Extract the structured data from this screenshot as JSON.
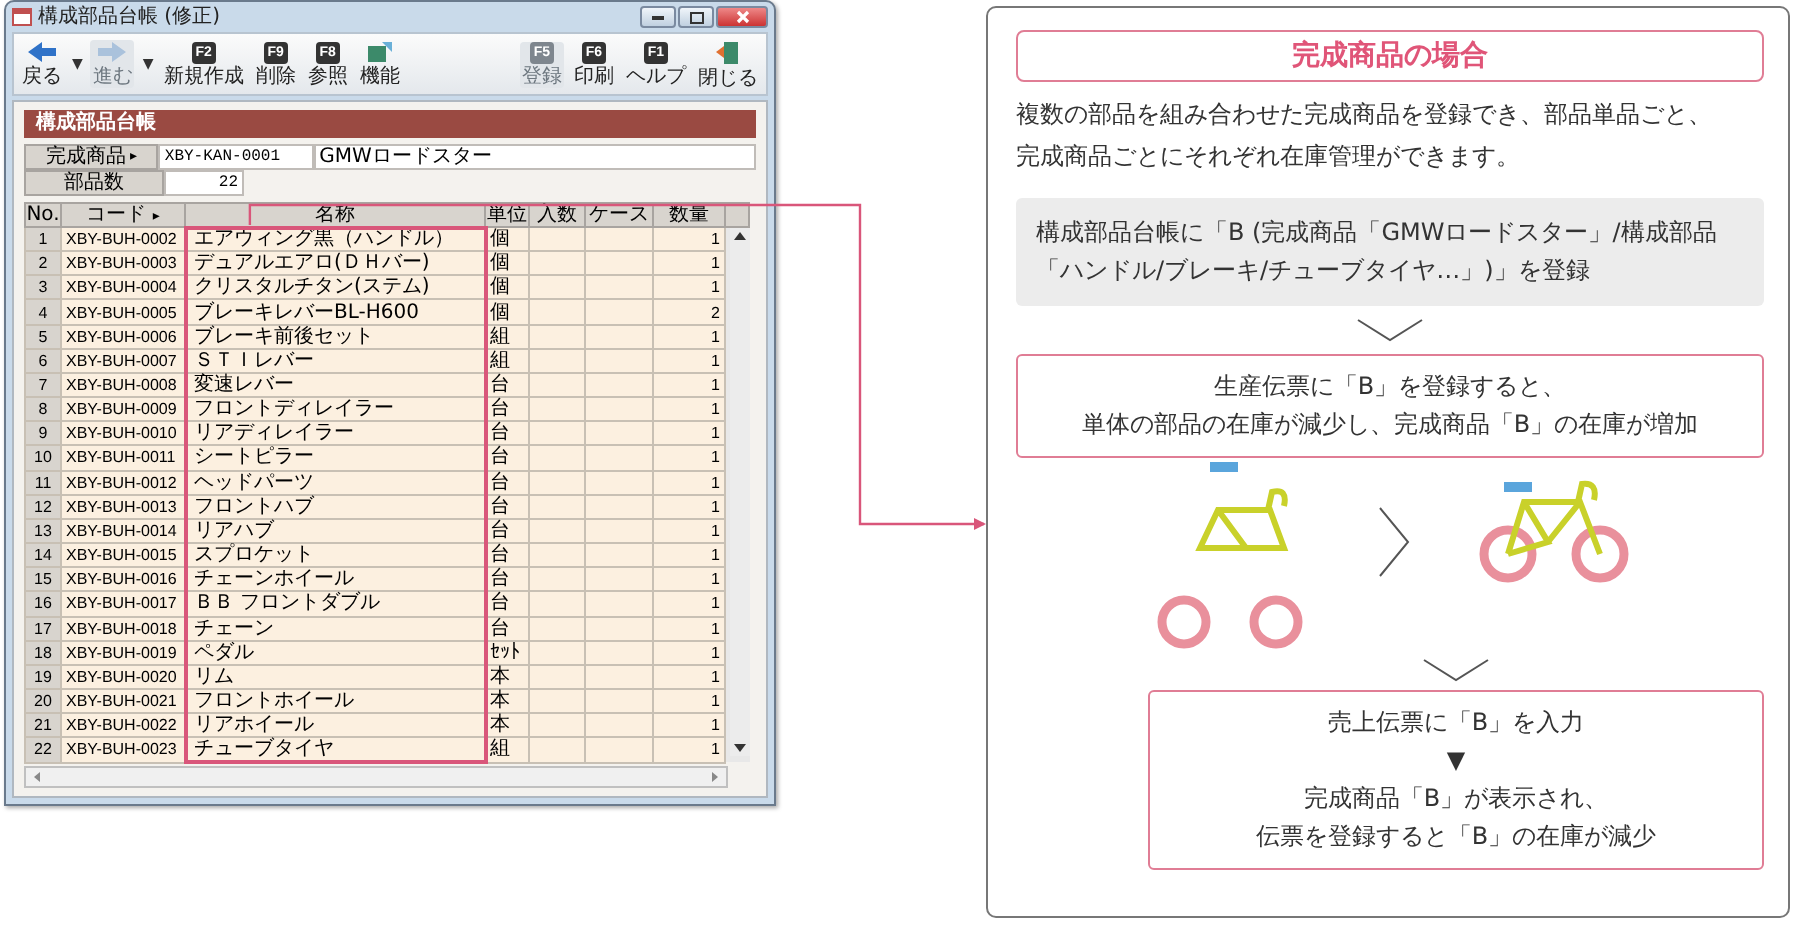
{
  "window": {
    "title": "構成部品台帳 (修正)",
    "toolbar_left": [
      {
        "kind": "back",
        "label": "戻る",
        "caret": "▼",
        "disabled": false
      },
      {
        "kind": "forward",
        "label": "進む",
        "caret": "▼",
        "disabled": true
      },
      {
        "kind": "key",
        "key": "F2",
        "label": "新規作成",
        "disabled": false
      },
      {
        "kind": "key",
        "key": "F9",
        "label": "削除",
        "disabled": false
      },
      {
        "kind": "key",
        "key": "F8",
        "label": "参照",
        "disabled": false
      },
      {
        "kind": "tool",
        "label": "機能",
        "disabled": false
      }
    ],
    "toolbar_right": [
      {
        "kind": "key",
        "key": "F5",
        "label": "登録",
        "disabled": true
      },
      {
        "kind": "key",
        "key": "F6",
        "label": "印刷",
        "disabled": false
      },
      {
        "kind": "key",
        "key": "F1",
        "label": "ヘルプ",
        "disabled": false
      },
      {
        "kind": "exit",
        "label": "閉じる",
        "disabled": false
      }
    ],
    "form_title": "構成部品台帳",
    "fields": [
      {
        "label": "完成商品",
        "lookup_mark": "▸",
        "values": [
          "XBY-KAN-0001",
          "GMWロードスター"
        ]
      },
      {
        "label": "部品数",
        "values": [
          "22"
        ]
      }
    ],
    "table": {
      "columns": [
        {
          "label": "No."
        },
        {
          "label": "コード",
          "lookup_mark": "▸"
        },
        {
          "label": "名称"
        },
        {
          "label": "単位"
        },
        {
          "label": "入数"
        },
        {
          "label": "ケース"
        },
        {
          "label": "数量"
        }
      ],
      "rows": [
        {
          "no": "1",
          "code": "XBY-BUH-0002",
          "name": "エアウィング黒（ハンドル）",
          "unit": "個",
          "qty": "1"
        },
        {
          "no": "2",
          "code": "XBY-BUH-0003",
          "name": "デュアルエアロ(ＤＨバー)",
          "unit": "個",
          "qty": "1"
        },
        {
          "no": "3",
          "code": "XBY-BUH-0004",
          "name": "クリスタルチタン(ステム)",
          "unit": "個",
          "qty": "1"
        },
        {
          "no": "4",
          "code": "XBY-BUH-0005",
          "name": "ブレーキレバーBL-H600",
          "unit": "個",
          "qty": "2"
        },
        {
          "no": "5",
          "code": "XBY-BUH-0006",
          "name": "ブレーキ前後セット",
          "unit": "組",
          "qty": "1"
        },
        {
          "no": "6",
          "code": "XBY-BUH-0007",
          "name": "ＳＴＩレバー",
          "unit": "組",
          "qty": "1"
        },
        {
          "no": "7",
          "code": "XBY-BUH-0008",
          "name": "変速レバー",
          "unit": "台",
          "qty": "1"
        },
        {
          "no": "8",
          "code": "XBY-BUH-0009",
          "name": "フロントディレイラー",
          "unit": "台",
          "qty": "1"
        },
        {
          "no": "9",
          "code": "XBY-BUH-0010",
          "name": "リアディレイラー",
          "unit": "台",
          "qty": "1"
        },
        {
          "no": "10",
          "code": "XBY-BUH-0011",
          "name": "シートピラー",
          "unit": "台",
          "qty": "1"
        },
        {
          "no": "11",
          "code": "XBY-BUH-0012",
          "name": "ヘッドパーツ",
          "unit": "台",
          "qty": "1"
        },
        {
          "no": "12",
          "code": "XBY-BUH-0013",
          "name": "フロントハブ",
          "unit": "台",
          "qty": "1"
        },
        {
          "no": "13",
          "code": "XBY-BUH-0014",
          "name": "リアハブ",
          "unit": "台",
          "qty": "1"
        },
        {
          "no": "14",
          "code": "XBY-BUH-0015",
          "name": "スプロケット",
          "unit": "台",
          "qty": "1"
        },
        {
          "no": "15",
          "code": "XBY-BUH-0016",
          "name": "チェーンホイール",
          "unit": "台",
          "qty": "1"
        },
        {
          "no": "16",
          "code": "XBY-BUH-0017",
          "name": "ＢＢ フロントダブル",
          "unit": "台",
          "qty": "1"
        },
        {
          "no": "17",
          "code": "XBY-BUH-0018",
          "name": "チェーン",
          "unit": "台",
          "qty": "1"
        },
        {
          "no": "18",
          "code": "XBY-BUH-0019",
          "name": "ペダル",
          "unit": "ｾｯﾄ",
          "qty": "1"
        },
        {
          "no": "19",
          "code": "XBY-BUH-0020",
          "name": "リム",
          "unit": "本",
          "qty": "1"
        },
        {
          "no": "20",
          "code": "XBY-BUH-0021",
          "name": "フロントホイール",
          "unit": "本",
          "qty": "1"
        },
        {
          "no": "21",
          "code": "XBY-BUH-0022",
          "name": "リアホイール",
          "unit": "本",
          "qty": "1"
        },
        {
          "no": "22",
          "code": "XBY-BUH-0023",
          "name": "チューブタイヤ",
          "unit": "組",
          "qty": "1"
        }
      ]
    }
  },
  "panel": {
    "title": "完成商品の場合",
    "description": [
      "複数の部品を組み合わせた完成商品を登録でき、部品単品ごと、",
      "完成商品ごとにそれぞれ在庫管理ができます。"
    ],
    "steps": [
      {
        "kind": "grey",
        "lines": [
          "構成部品台帳に「B (完成商品「GMWロードスター」/構成部品",
          "「ハンドル/ブレーキ/チューブタイヤ…」)」を登録"
        ]
      },
      {
        "kind": "outlined",
        "lines": [
          "生産伝票に「B」を登録すると、",
          "単体の部品の在庫が減少し、完成商品「B」の在庫が増加"
        ]
      },
      {
        "kind": "bikes"
      },
      {
        "kind": "outlined_short",
        "lines": [
          "売上伝票に「B」を入力",
          "▼",
          "完成商品「B」が表示され、",
          "伝票を登録すると「B」の在庫が減少"
        ]
      }
    ]
  }
}
